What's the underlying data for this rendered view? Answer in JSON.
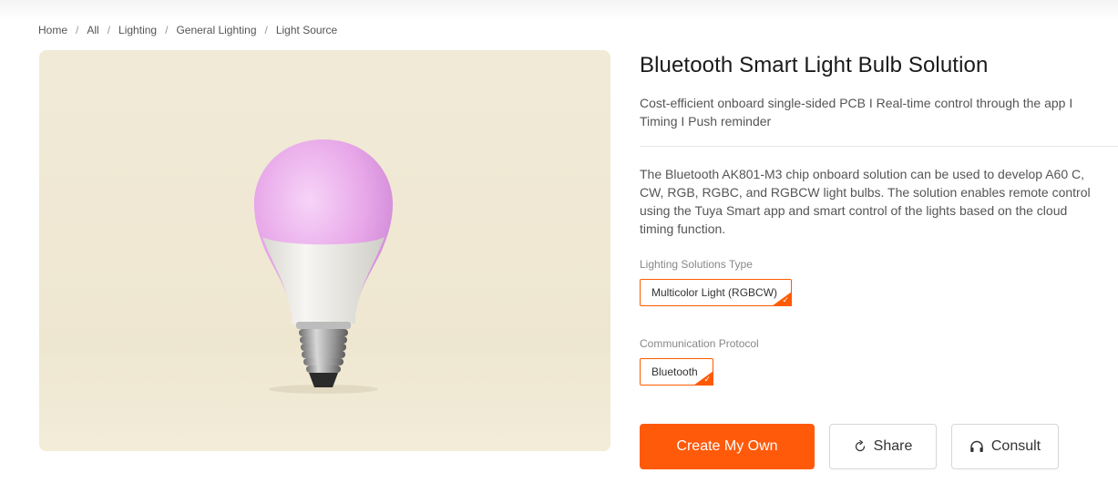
{
  "breadcrumb": [
    "Home",
    "All",
    "Lighting",
    "General Lighting",
    "Light Source"
  ],
  "product": {
    "title": "Bluetooth Smart Light Bulb Solution",
    "subtitle": "Cost-efficient onboard single-sided PCB I Real-time control through the app I Timing I Push reminder",
    "description": "The Bluetooth AK801-M3 chip onboard solution can be used to develop A60 C, CW, RGB, RGBC, and RGBCW light bulbs. The solution enables remote control using the Tuya Smart app and smart control of the lights based on the cloud timing function."
  },
  "options": {
    "lighting_type": {
      "label": "Lighting Solutions Type",
      "selected": "Multicolor Light (RGBCW)"
    },
    "protocol": {
      "label": "Communication Protocol",
      "selected": "Bluetooth"
    }
  },
  "actions": {
    "create": "Create My Own",
    "share": "Share",
    "consult": "Consult"
  },
  "icons": {
    "share": "share-icon",
    "consult": "headset-icon",
    "selected": "check-icon"
  },
  "colors": {
    "accent": "#ff5a0a",
    "image_background": "#f0e9d5",
    "bulb_glow": "#e7a6e8"
  }
}
